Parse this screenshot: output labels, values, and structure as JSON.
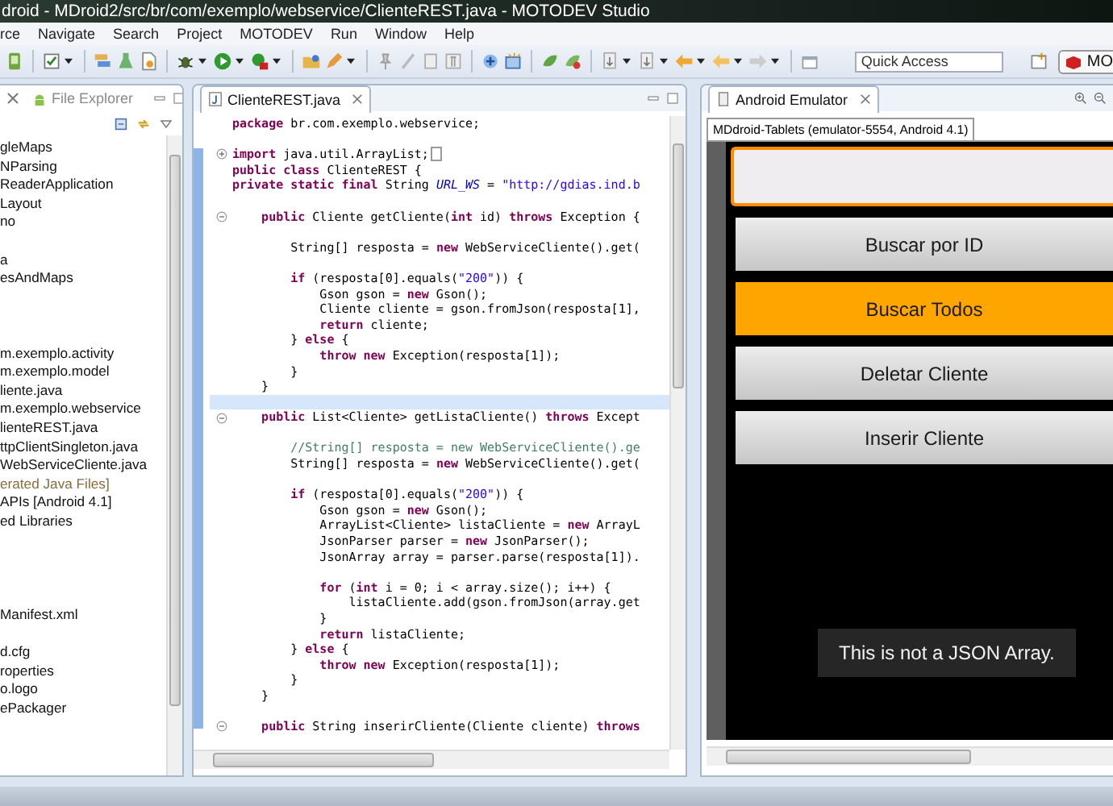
{
  "window": {
    "title": "droid - MDroid2/src/br/com/exemplo/webservice/ClienteREST.java - MOTODEV Studio"
  },
  "menu": [
    "rce",
    "Navigate",
    "Search",
    "Project",
    "MOTODEV",
    "Run",
    "Window",
    "Help"
  ],
  "toolbar": {
    "quick_access": {
      "placeholder": "Quick Access"
    },
    "perspective": {
      "label": "MO"
    }
  },
  "explorer": {
    "tab_label": "File Explorer",
    "items": [
      {
        "kind": "row",
        "text": "gleMaps"
      },
      {
        "kind": "row",
        "text": "NParsing"
      },
      {
        "kind": "row",
        "text": "ReaderApplication"
      },
      {
        "kind": "row",
        "text": "Layout"
      },
      {
        "kind": "row",
        "text": "no"
      },
      {
        "kind": "cut"
      },
      {
        "kind": "row",
        "text": "a"
      },
      {
        "kind": "row",
        "text": "esAndMaps"
      },
      {
        "kind": "cut"
      },
      {
        "kind": "cut"
      },
      {
        "kind": "cut"
      },
      {
        "kind": "row",
        "text": "m.exemplo.activity"
      },
      {
        "kind": "row",
        "text": "m.exemplo.model"
      },
      {
        "kind": "row",
        "text": "liente.java"
      },
      {
        "kind": "row",
        "text": "m.exemplo.webservice"
      },
      {
        "kind": "row",
        "text": "lienteREST.java"
      },
      {
        "kind": "row",
        "text": "ttpClientSingleton.java"
      },
      {
        "kind": "row",
        "text": "WebServiceCliente.java"
      },
      {
        "kind": "derived",
        "text": "erated Java Files]"
      },
      {
        "kind": "row",
        "text": "APIs [Android 4.1]"
      },
      {
        "kind": "row",
        "text": "ed Libraries"
      },
      {
        "kind": "cut"
      },
      {
        "kind": "cut"
      },
      {
        "kind": "cut"
      },
      {
        "kind": "cut"
      },
      {
        "kind": "row",
        "text": "Manifest.xml"
      },
      {
        "kind": "cut"
      },
      {
        "kind": "row",
        "text": "d.cfg"
      },
      {
        "kind": "row",
        "text": "roperties"
      },
      {
        "kind": "row",
        "text": "o.logo"
      },
      {
        "kind": "row",
        "text": "ePackager"
      }
    ]
  },
  "editor": {
    "tab_label": "ClienteREST.java",
    "lines": [
      {
        "current": false,
        "segments": [
          {
            "kind": "kw",
            "text": "package"
          },
          {
            "kind": "plain",
            "text": " br.com.exemplo.webservice;"
          }
        ]
      },
      {
        "current": false
      },
      {
        "current": false,
        "collapsed": true,
        "segments": [
          {
            "kind": "kw",
            "text": "import"
          },
          {
            "kind": "plain",
            "text": " java.util.ArrayList;"
          }
        ]
      },
      {
        "current": false,
        "segments": [
          {
            "kind": "kw",
            "text": "public class"
          },
          {
            "kind": "plain",
            "text": " ClienteREST {"
          }
        ]
      },
      {
        "current": false,
        "segments": [
          {
            "kind": "kw",
            "text": "private static final"
          },
          {
            "kind": "plain",
            "text": " String "
          },
          {
            "kind": "field",
            "text": "URL_WS"
          },
          {
            "kind": "plain",
            "text": " = "
          },
          {
            "kind": "str",
            "text": "\"http://gdias.ind.b"
          }
        ]
      },
      {
        "current": false
      },
      {
        "current": false,
        "collapsed": false,
        "segments": [
          {
            "kind": "kw",
            "text": "    public"
          },
          {
            "kind": "plain",
            "text": " Cliente getCliente("
          },
          {
            "kind": "kw",
            "text": "int"
          },
          {
            "kind": "plain",
            "text": " id) "
          },
          {
            "kind": "kw",
            "text": "throws"
          },
          {
            "kind": "plain",
            "text": " Exception {"
          }
        ]
      },
      {
        "current": false
      },
      {
        "current": false,
        "segments": [
          {
            "kind": "plain",
            "text": "        String[] resposta = "
          },
          {
            "kind": "kw",
            "text": "new"
          },
          {
            "kind": "plain",
            "text": " WebServiceCliente().get("
          }
        ]
      },
      {
        "current": false
      },
      {
        "current": false,
        "segments": [
          {
            "kind": "kw",
            "text": "        if"
          },
          {
            "kind": "plain",
            "text": " (resposta[0].equals("
          },
          {
            "kind": "str",
            "text": "\"200\""
          },
          {
            "kind": "plain",
            "text": ")) {"
          }
        ]
      },
      {
        "current": false,
        "segments": [
          {
            "kind": "plain",
            "text": "            Gson gson = "
          },
          {
            "kind": "kw",
            "text": "new"
          },
          {
            "kind": "plain",
            "text": " Gson();"
          }
        ]
      },
      {
        "current": false,
        "segments": [
          {
            "kind": "plain",
            "text": "            Cliente cliente = gson.fromJson(resposta[1],"
          }
        ]
      },
      {
        "current": false,
        "segments": [
          {
            "kind": "kw",
            "text": "            return"
          },
          {
            "kind": "plain",
            "text": " cliente;"
          }
        ]
      },
      {
        "current": false,
        "segments": [
          {
            "kind": "plain",
            "text": "        } "
          },
          {
            "kind": "kw",
            "text": "else"
          },
          {
            "kind": "plain",
            "text": " {"
          }
        ]
      },
      {
        "current": false,
        "segments": [
          {
            "kind": "kw",
            "text": "            throw new"
          },
          {
            "kind": "plain",
            "text": " Exception(resposta[1]);"
          }
        ]
      },
      {
        "current": false,
        "segments": [
          {
            "kind": "plain",
            "text": "        }"
          }
        ]
      },
      {
        "current": false,
        "segments": [
          {
            "kind": "plain",
            "text": "    }"
          }
        ]
      },
      {
        "current": true
      },
      {
        "current": false,
        "collapsed": false,
        "segments": [
          {
            "kind": "kw",
            "text": "    public"
          },
          {
            "kind": "plain",
            "text": " List<Cliente> getListaCliente() "
          },
          {
            "kind": "kw",
            "text": "throws"
          },
          {
            "kind": "plain",
            "text": " Except"
          }
        ]
      },
      {
        "current": false
      },
      {
        "current": false,
        "segments": [
          {
            "kind": "comment",
            "text": "        //String[] resposta = new WebServiceCliente().ge"
          }
        ]
      },
      {
        "current": false,
        "segments": [
          {
            "kind": "plain",
            "text": "        String[] resposta = "
          },
          {
            "kind": "kw",
            "text": "new"
          },
          {
            "kind": "plain",
            "text": " WebServiceCliente().get("
          }
        ]
      },
      {
        "current": false
      },
      {
        "current": false,
        "segments": [
          {
            "kind": "kw",
            "text": "        if"
          },
          {
            "kind": "plain",
            "text": " (resposta[0].equals("
          },
          {
            "kind": "str",
            "text": "\"200\""
          },
          {
            "kind": "plain",
            "text": ")) {"
          }
        ]
      },
      {
        "current": false,
        "segments": [
          {
            "kind": "plain",
            "text": "            Gson gson = "
          },
          {
            "kind": "kw",
            "text": "new"
          },
          {
            "kind": "plain",
            "text": " Gson();"
          }
        ]
      },
      {
        "current": false,
        "segments": [
          {
            "kind": "plain",
            "text": "            ArrayList<Cliente> listaCliente = "
          },
          {
            "kind": "kw",
            "text": "new"
          },
          {
            "kind": "plain",
            "text": " ArrayL"
          }
        ]
      },
      {
        "current": false,
        "segments": [
          {
            "kind": "plain",
            "text": "            JsonParser parser = "
          },
          {
            "kind": "kw",
            "text": "new"
          },
          {
            "kind": "plain",
            "text": " JsonParser();"
          }
        ]
      },
      {
        "current": false,
        "segments": [
          {
            "kind": "plain",
            "text": "            JsonArray array = parser.parse(resposta[1])."
          }
        ]
      },
      {
        "current": false
      },
      {
        "current": false,
        "segments": [
          {
            "kind": "kw",
            "text": "            for"
          },
          {
            "kind": "plain",
            "text": " ("
          },
          {
            "kind": "kw",
            "text": "int"
          },
          {
            "kind": "plain",
            "text": " i = 0; i < array.size(); i++) {"
          }
        ]
      },
      {
        "current": false,
        "segments": [
          {
            "kind": "plain",
            "text": "                listaCliente.add(gson.fromJson(array.get"
          }
        ]
      },
      {
        "current": false,
        "segments": [
          {
            "kind": "plain",
            "text": "            }"
          }
        ]
      },
      {
        "current": false,
        "segments": [
          {
            "kind": "kw",
            "text": "            return"
          },
          {
            "kind": "plain",
            "text": " listaCliente;"
          }
        ]
      },
      {
        "current": false,
        "segments": [
          {
            "kind": "plain",
            "text": "        } "
          },
          {
            "kind": "kw",
            "text": "else"
          },
          {
            "kind": "plain",
            "text": " {"
          }
        ]
      },
      {
        "current": false,
        "segments": [
          {
            "kind": "kw",
            "text": "            throw new"
          },
          {
            "kind": "plain",
            "text": " Exception(resposta[1]);"
          }
        ]
      },
      {
        "current": false,
        "segments": [
          {
            "kind": "plain",
            "text": "        }"
          }
        ]
      },
      {
        "current": false,
        "segments": [
          {
            "kind": "plain",
            "text": "    }"
          }
        ]
      },
      {
        "current": false
      },
      {
        "current": false,
        "collapsed": false,
        "segments": [
          {
            "kind": "kw",
            "text": "    public"
          },
          {
            "kind": "plain",
            "text": " String inserirCliente(Cliente cliente) "
          },
          {
            "kind": "kw",
            "text": "throws"
          }
        ]
      }
    ]
  },
  "emulator": {
    "tab_label": "Android Emulator",
    "device_tab": "MDdroid-Tablets (emulator-5554, Android 4.1)",
    "input": {
      "focused": true
    },
    "buttons": [
      {
        "label": "Buscar por ID",
        "pressed": false
      },
      {
        "label": "Buscar Todos",
        "pressed": true
      },
      {
        "label": "Deletar Cliente",
        "pressed": false
      },
      {
        "label": "Inserir Cliente",
        "pressed": false
      }
    ],
    "toast": "This is not a JSON Array."
  }
}
